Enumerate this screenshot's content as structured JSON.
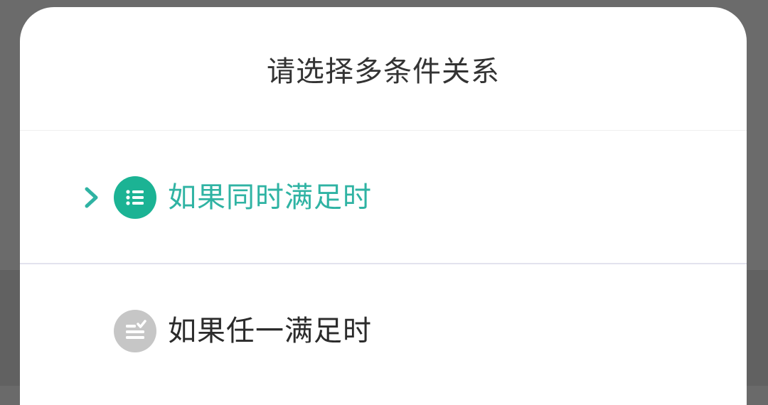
{
  "dialog": {
    "title": "请选择多条件关系",
    "options": [
      {
        "label": "如果同时满足时",
        "selected": true,
        "icon": "list-icon",
        "color": "#2fb3a3",
        "icon_bg": "#1bb394"
      },
      {
        "label": "如果任一满足时",
        "selected": false,
        "icon": "list-check-icon",
        "color": "#2b2b2b",
        "icon_bg": "#c6c6c6"
      }
    ],
    "selected_indicator_icon": "chevron-right-icon"
  }
}
